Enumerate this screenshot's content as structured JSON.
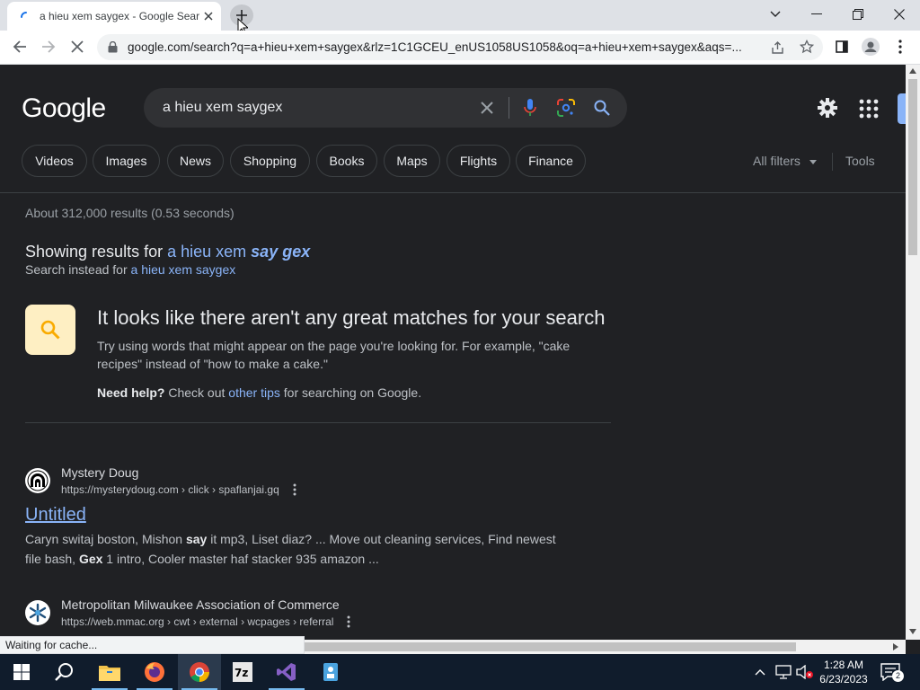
{
  "browser": {
    "tab_title": "a hieu xem saygex - Google Sear",
    "url": "google.com/search?q=a+hieu+xem+saygex&rlz=1C1GCEU_enUS1058US1058&oq=a+hieu+xem+saygex&aqs=...",
    "status_text": "Waiting for cache..."
  },
  "google": {
    "logo": "Google",
    "query": "a hieu xem saygex",
    "filters": [
      "Videos",
      "Images",
      "News",
      "Shopping",
      "Books",
      "Maps",
      "Flights",
      "Finance"
    ],
    "all_filters": "All filters",
    "tools": "Tools",
    "stats": "About 312,000 results (0.53 seconds)",
    "showing_prefix": "Showing results for",
    "showing_plain": "a hieu xem",
    "showing_bold": "say gex",
    "instead_prefix": "Search instead for",
    "instead_link": "a hieu xem saygex",
    "nomatch_title": "It looks like there aren't any great matches for your search",
    "nomatch_desc": "Try using words that might appear on the page you're looking for. For example, \"cake recipes\" instead of \"how to make a cake.\"",
    "help_bold": "Need help?",
    "help_mid": "Check out",
    "help_link": "other tips",
    "help_end": "for searching on Google."
  },
  "results": [
    {
      "site": "Mystery Doug",
      "cite": "https://mysterydoug.com › click › spaflanjai.gq",
      "title": "Untitled",
      "snippet_parts": [
        "Caryn switaj boston, Mishon ",
        "say",
        " it mp3, Liset diaz? ... Move out cleaning services, Find newest file bash, ",
        "Gex",
        " 1 intro, Cooler master haf stacker 935 amazon ..."
      ]
    },
    {
      "site": "Metropolitan Milwaukee Association of Commerce",
      "cite": "https://web.mmac.org › cwt › external › wcpages › referral"
    }
  ],
  "taskbar": {
    "time": "1:28 AM",
    "date": "6/23/2023",
    "notifications": "2"
  },
  "colors": {
    "page_bg": "#202124",
    "link": "#8ab4f8",
    "taskbar": "#101c2c"
  }
}
